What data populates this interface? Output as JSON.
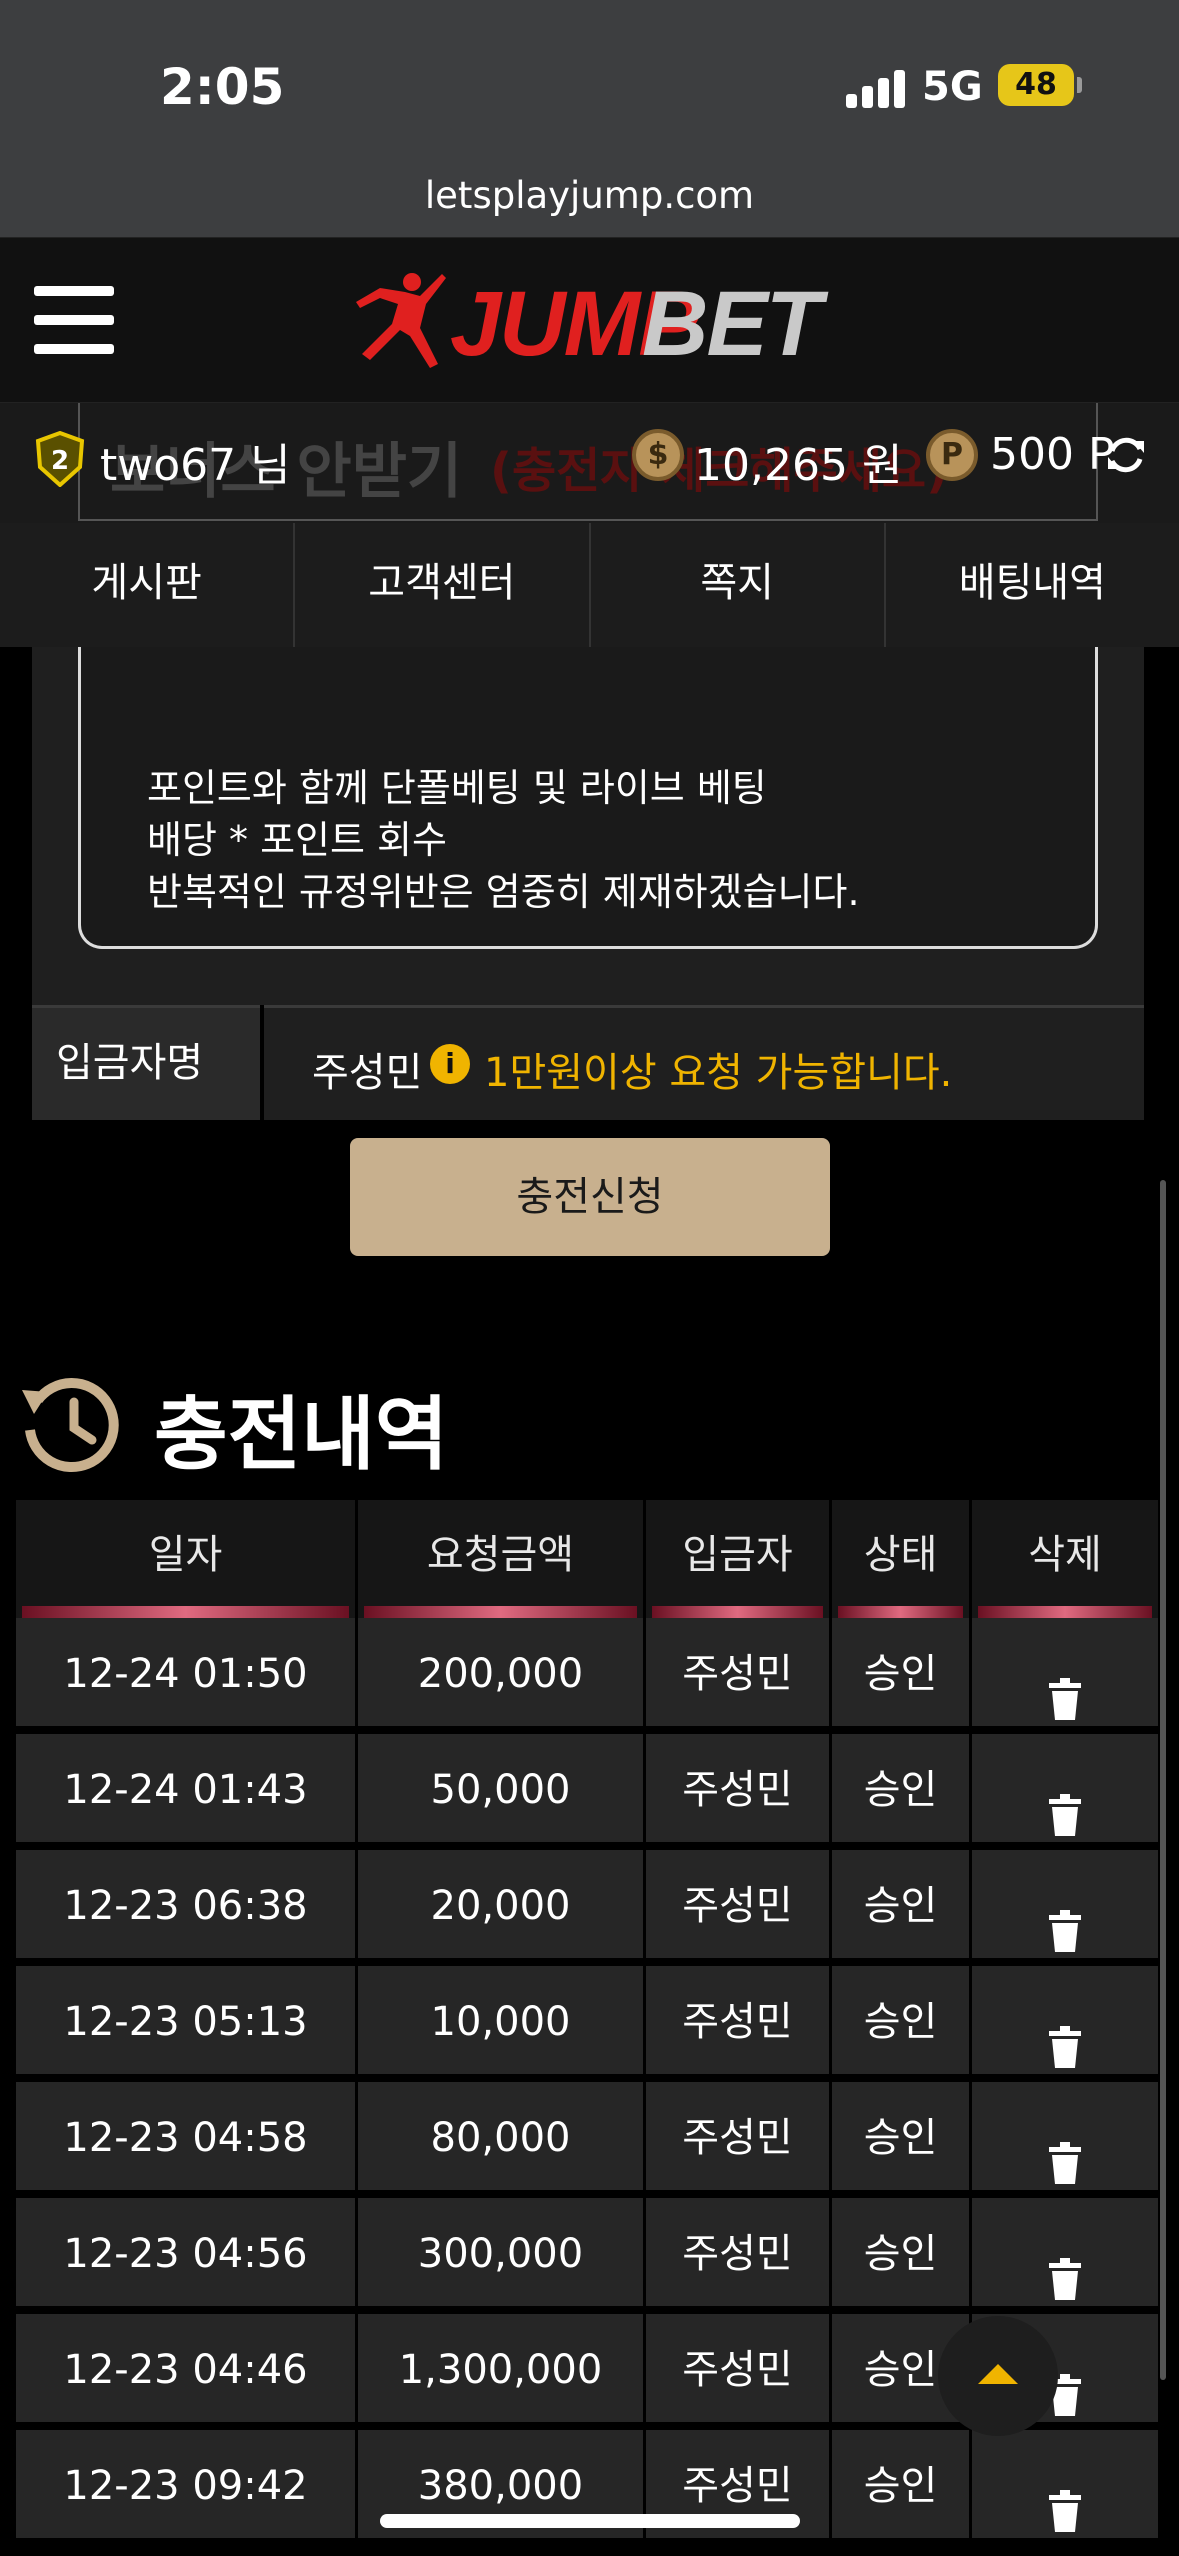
{
  "status_bar": {
    "time": "2:05",
    "network": "5G",
    "battery": "48"
  },
  "browser": {
    "url": "letsplayjump.com"
  },
  "header": {
    "logo_jump": "JUMP",
    "logo_bet": "BET"
  },
  "user": {
    "level": "2",
    "name": "two67 님",
    "money": "10,265 원",
    "points": "500 P"
  },
  "behind_notice": {
    "title": "보너스 안받기",
    "red_text": "(충전자 체크해주세요)"
  },
  "nav": {
    "items": [
      {
        "label": "게시판"
      },
      {
        "label": "고객센터"
      },
      {
        "label": "쪽지"
      },
      {
        "label": "배팅내역"
      }
    ]
  },
  "notice": {
    "lines": [
      "포인트와 함께 단폴베팅 및 라이브 베팅",
      "배당 * 포인트 회수",
      "반복적인 규정위반은 엄중히 제재하겠습니다."
    ]
  },
  "depositor": {
    "label": "입금자명",
    "name": "주성민",
    "hint": "1만원이상 요청 가능합니다."
  },
  "charge_button": "충전신청",
  "history": {
    "title": "충전내역",
    "columns": [
      "일자",
      "요청금액",
      "입금자",
      "상태",
      "삭제"
    ],
    "rows": [
      {
        "date": "12-24 01:50",
        "amount": "200,000",
        "depositor": "주성민",
        "status": "승인"
      },
      {
        "date": "12-24 01:43",
        "amount": "50,000",
        "depositor": "주성민",
        "status": "승인"
      },
      {
        "date": "12-23 06:38",
        "amount": "20,000",
        "depositor": "주성민",
        "status": "승인"
      },
      {
        "date": "12-23 05:13",
        "amount": "10,000",
        "depositor": "주성민",
        "status": "승인"
      },
      {
        "date": "12-23 04:58",
        "amount": "80,000",
        "depositor": "주성민",
        "status": "승인"
      },
      {
        "date": "12-23 04:56",
        "amount": "300,000",
        "depositor": "주성민",
        "status": "승인"
      },
      {
        "date": "12-23 04:46",
        "amount": "1,300,000",
        "depositor": "주성민",
        "status": "승인"
      },
      {
        "date": "12-23 09:42",
        "amount": "380,000",
        "depositor": "주성민",
        "status": "승인"
      }
    ]
  },
  "colors": {
    "accent_gold": "#f0b400",
    "brand_red": "#e0201f",
    "button_tan": "#c8b08e"
  }
}
